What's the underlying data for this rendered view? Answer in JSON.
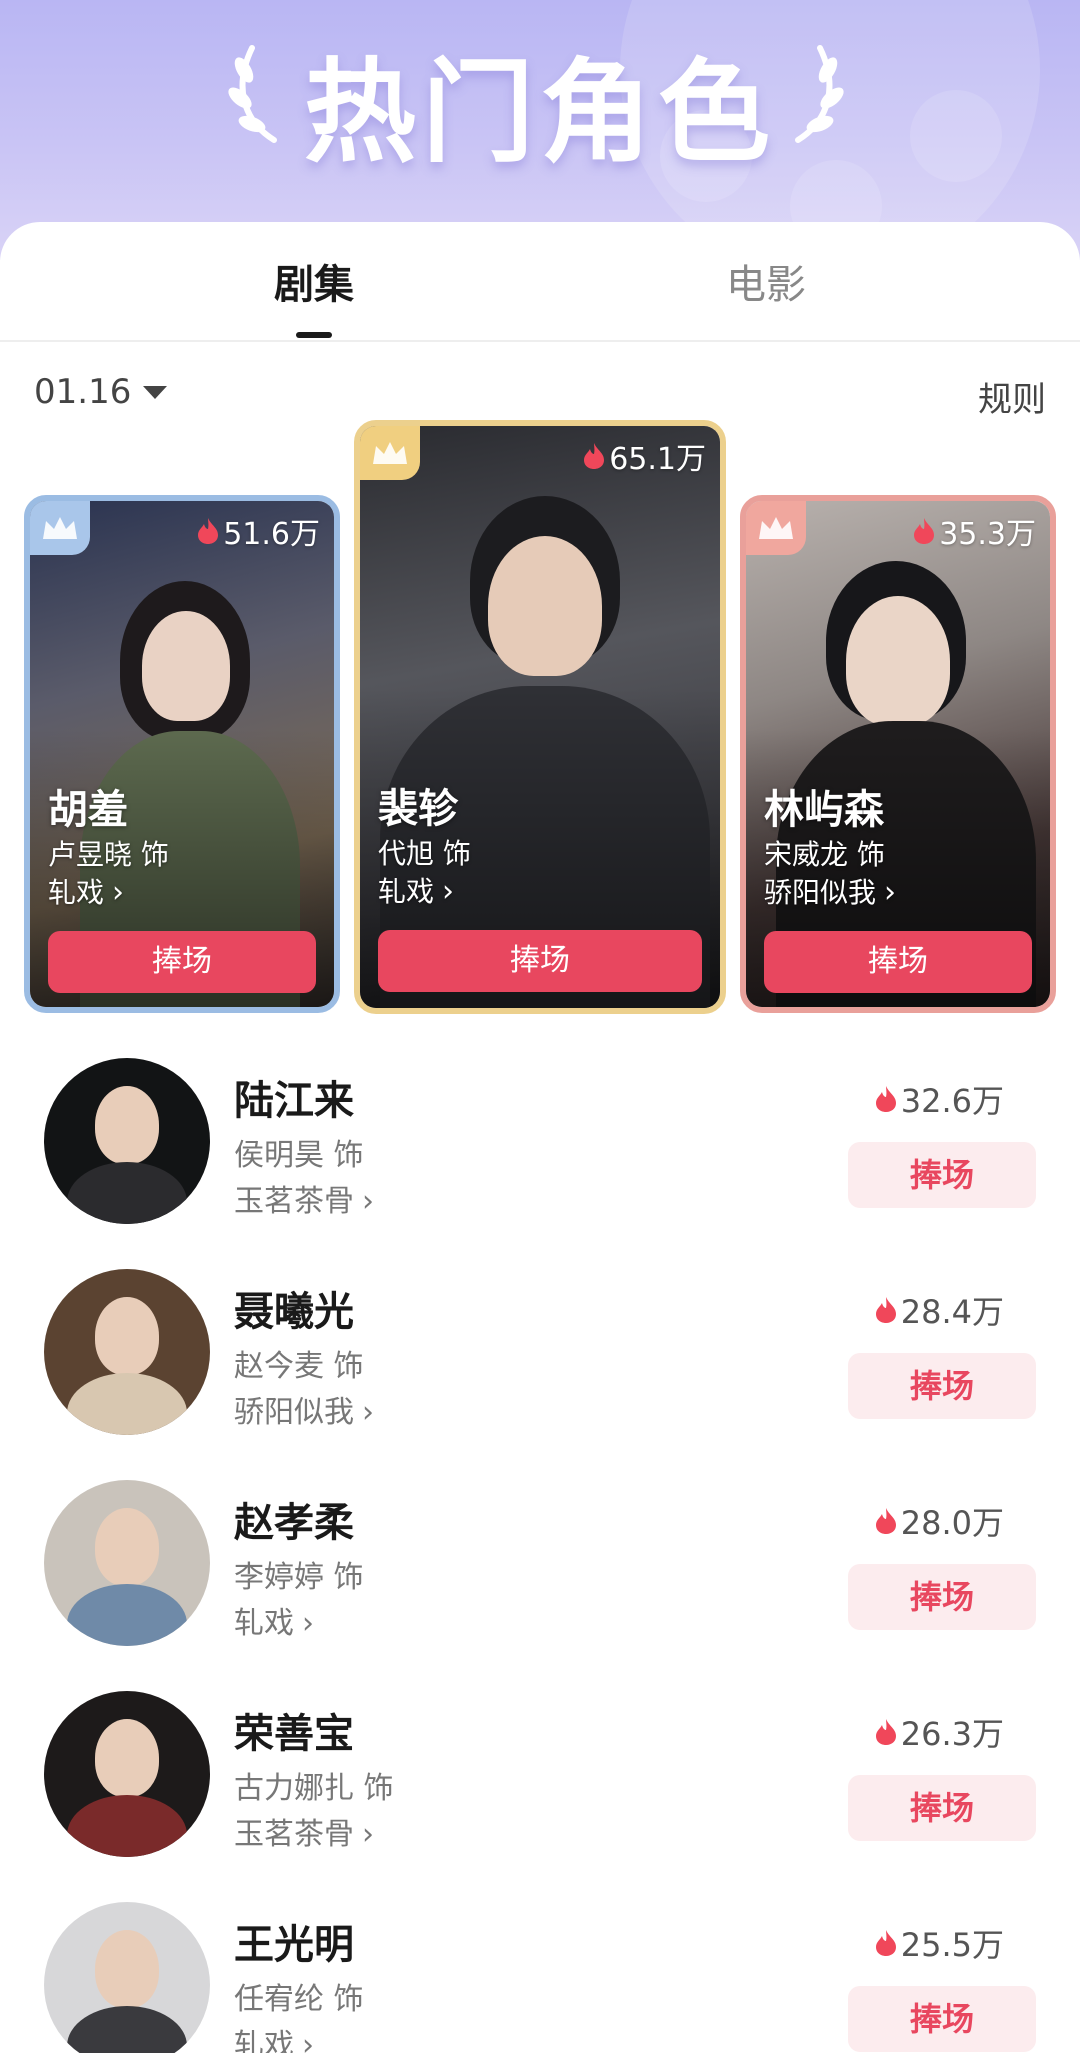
{
  "header": {
    "title": "热门角色"
  },
  "tabs": [
    {
      "label": "剧集",
      "active": true
    },
    {
      "label": "电影",
      "active": false
    }
  ],
  "filter": {
    "date": "01.16",
    "rules_label": "规则"
  },
  "colors": {
    "accent": "#e8475f",
    "accent_soft": "#fcecee",
    "banner": "#c9c4f5"
  },
  "top3": [
    {
      "rank": 2,
      "heat": "51.6万",
      "name": "胡羞",
      "actor": "卢昱晓 饰",
      "show": "轧戏",
      "button": "捧场"
    },
    {
      "rank": 1,
      "heat": "65.1万",
      "name": "裴轸",
      "actor": "代旭 饰",
      "show": "轧戏",
      "button": "捧场"
    },
    {
      "rank": 3,
      "heat": "35.3万",
      "name": "林屿森",
      "actor": "宋威龙 饰",
      "show": "骄阳似我",
      "button": "捧场"
    }
  ],
  "list": [
    {
      "name": "陆江来",
      "actor": "侯明昊 饰",
      "show": "玉茗茶骨",
      "heat": "32.6万",
      "button": "捧场"
    },
    {
      "name": "聂曦光",
      "actor": "赵今麦 饰",
      "show": "骄阳似我",
      "heat": "28.4万",
      "button": "捧场"
    },
    {
      "name": "赵孝柔",
      "actor": "李婷婷 饰",
      "show": "轧戏",
      "heat": "28.0万",
      "button": "捧场"
    },
    {
      "name": "荣善宝",
      "actor": "古力娜扎 饰",
      "show": "玉茗茶骨",
      "heat": "26.3万",
      "button": "捧场"
    },
    {
      "name": "王光明",
      "actor": "任宥纶 饰",
      "show": "轧戏",
      "heat": "25.5万",
      "button": "捧场"
    }
  ],
  "icons": {
    "crown": "crown-icon",
    "flame": "flame-icon",
    "chevron": "chevron-right-icon",
    "caret": "caret-down-icon"
  }
}
